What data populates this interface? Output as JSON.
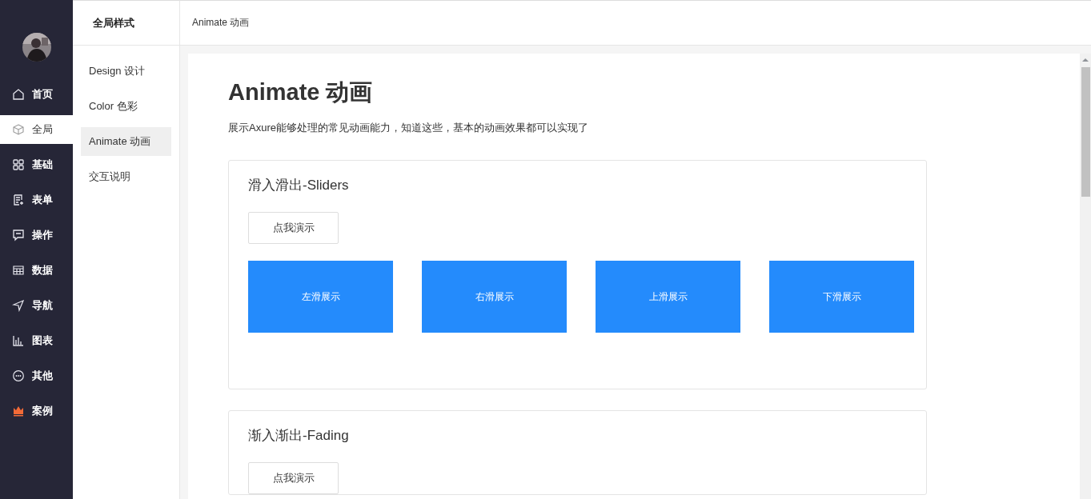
{
  "nav": {
    "items": [
      {
        "label": "首页",
        "selected": false
      },
      {
        "label": "全局",
        "selected": true
      },
      {
        "label": "基础",
        "selected": false
      },
      {
        "label": "表单",
        "selected": false
      },
      {
        "label": "操作",
        "selected": false
      },
      {
        "label": "数据",
        "selected": false
      },
      {
        "label": "导航",
        "selected": false
      },
      {
        "label": "图表",
        "selected": false
      },
      {
        "label": "其他",
        "selected": false
      },
      {
        "label": "案例",
        "selected": false
      }
    ]
  },
  "submenu": {
    "title": "全局样式",
    "items": [
      {
        "label": "Design 设计",
        "selected": false
      },
      {
        "label": "Color 色彩",
        "selected": false
      },
      {
        "label": "Animate 动画",
        "selected": true
      },
      {
        "label": "交互说明",
        "selected": false
      }
    ]
  },
  "breadcrumb": "Animate 动画",
  "page": {
    "title": "Animate 动画",
    "description": "展示Axure能够处理的常见动画能力，知道这些，基本的动画效果都可以实现了",
    "sections": [
      {
        "title": "滑入滑出-Sliders",
        "button": "点我演示",
        "tiles": [
          "左滑展示",
          "右滑展示",
          "上滑展示",
          "下滑展示"
        ]
      },
      {
        "title": "渐入渐出-Fading",
        "button": "点我演示"
      }
    ]
  }
}
